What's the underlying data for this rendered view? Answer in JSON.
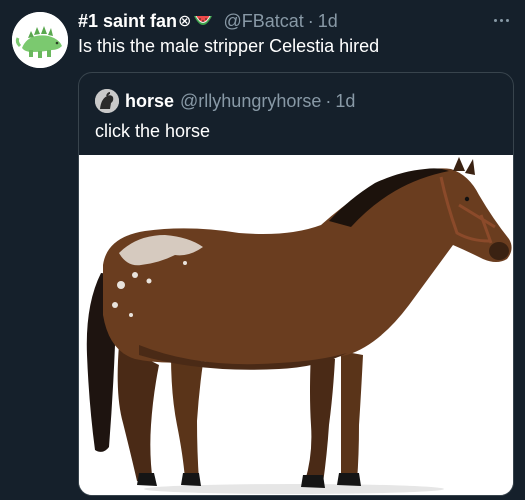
{
  "tweet": {
    "display_name": "#1 saint fan",
    "name_glyph": "⊗",
    "handle": "@FBatcat",
    "separator": "·",
    "time": "1d",
    "text": "Is this the male stripper Celestia hired"
  },
  "quoted_tweet": {
    "display_name": "horse",
    "handle": "@rllyhungryhorse",
    "separator": "·",
    "time": "1d",
    "text": "click the horse"
  },
  "icons": {
    "more": "more-horizontal-icon",
    "watermelon": "watermelon-emoji-icon"
  },
  "colors": {
    "background": "#15202b",
    "secondary_text": "#8899a6",
    "border": "#38444d",
    "primary_text": "#ffffff"
  }
}
